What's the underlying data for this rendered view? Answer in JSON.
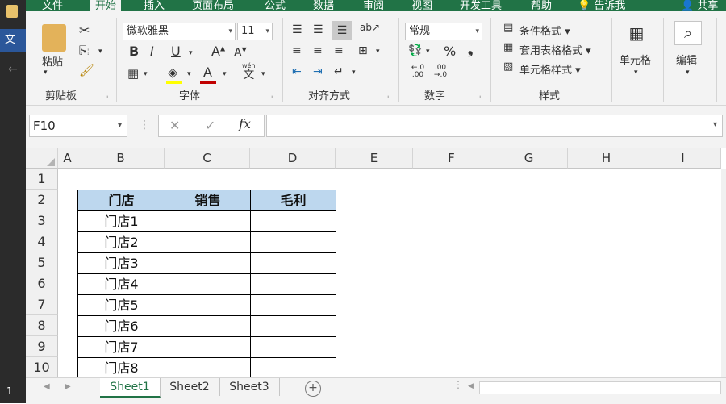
{
  "left_window": {
    "tab_char": "文",
    "line_number": "1"
  },
  "ribbon_tabs": [
    "文件",
    "开始",
    "插入",
    "页面布局",
    "公式",
    "数据",
    "审阅",
    "视图",
    "开发工具",
    "帮助",
    "告诉我",
    "共享"
  ],
  "ribbon": {
    "clipboard": {
      "paste_label": "粘贴",
      "group_label": "剪贴板"
    },
    "font": {
      "font_name": "微软雅黑",
      "font_size": "11",
      "bold": "B",
      "italic": "I",
      "underline": "U",
      "grow": "A",
      "shrink": "A",
      "wen": "wén",
      "wen_char": "文",
      "group_label": "字体"
    },
    "alignment": {
      "group_label": "对齐方式"
    },
    "number": {
      "format": "常规",
      "percent": "%",
      "comma": "9",
      "inc_dec": ".0 .00",
      "dec_dec": ".00 .0",
      "group_label": "数字"
    },
    "styles": {
      "conditional": "条件格式",
      "table_format": "套用表格格式",
      "cell_styles": "单元格样式",
      "group_label": "样式"
    },
    "cells": {
      "label": "单元格"
    },
    "editing": {
      "label": "编辑"
    }
  },
  "formula_bar": {
    "name_box": "F10",
    "cancel": "✕",
    "enter": "✓",
    "fx": "fx",
    "value": ""
  },
  "columns": [
    "A",
    "B",
    "C",
    "D",
    "E",
    "F",
    "G",
    "H",
    "I"
  ],
  "rows": [
    "1",
    "2",
    "3",
    "4",
    "5",
    "6",
    "7",
    "8",
    "9",
    "10"
  ],
  "table": {
    "headers": [
      "门店",
      "销售",
      "毛利"
    ],
    "stores": [
      "门店1",
      "门店2",
      "门店3",
      "门店4",
      "门店5",
      "门店6",
      "门店7",
      "门店8"
    ]
  },
  "sheets": [
    "Sheet1",
    "Sheet2",
    "Sheet3"
  ],
  "active_sheet": "Sheet1",
  "colors": {
    "accent": "#217346",
    "header_fill": "#bdd7ee",
    "font_color_bar": "#c00000",
    "highlight_bar": "#ffff00"
  }
}
